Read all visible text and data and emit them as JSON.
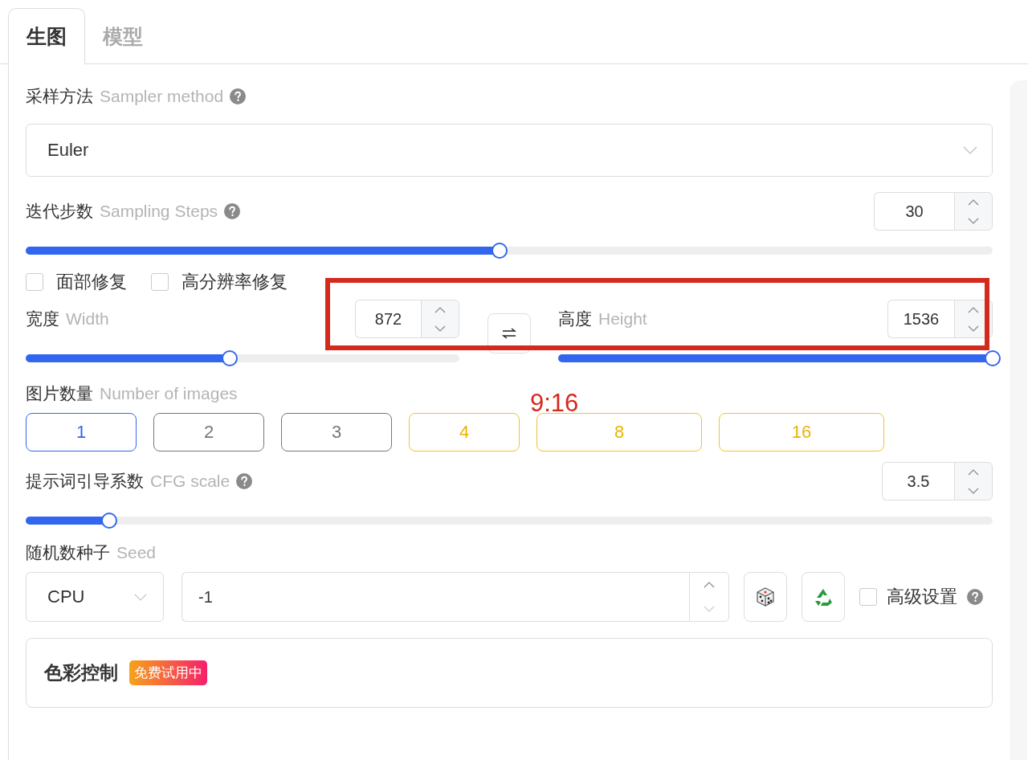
{
  "tabs": [
    {
      "label": "生图",
      "selected": true
    },
    {
      "label": "模型",
      "selected": false
    }
  ],
  "sampler": {
    "label": "采样方法",
    "hint": "Sampler method",
    "help": true,
    "value": "Euler"
  },
  "steps": {
    "label": "迭代步数",
    "hint": "Sampling Steps",
    "help": true,
    "value": "30",
    "level": 0.49
  },
  "options": [
    {
      "label": "面部修复",
      "checked": false
    },
    {
      "label": "高分辨率修复",
      "checked": false
    }
  ],
  "width": {
    "label": "宽度",
    "hint": "Width",
    "value": "872",
    "level": 0.47
  },
  "height": {
    "label": "高度",
    "hint": "Height",
    "value": "1536",
    "level": 1
  },
  "images": {
    "label": "图片数量",
    "hint": "Number of images",
    "options": [
      {
        "label": "1",
        "selected": true,
        "kind": "standard"
      },
      {
        "label": "2",
        "selected": false,
        "kind": "standard"
      },
      {
        "label": "3",
        "selected": false,
        "kind": "standard"
      },
      {
        "label": "4",
        "selected": false,
        "kind": "premium"
      },
      {
        "label": "8",
        "selected": false,
        "kind": "premium"
      },
      {
        "label": "16",
        "selected": false,
        "kind": "premium"
      }
    ]
  },
  "cfg": {
    "label": "提示词引导系数",
    "hint": "CFG scale",
    "help": true,
    "value": "3.5",
    "level": 0.086
  },
  "seed": {
    "label": "随机数种子",
    "hint": "Seed",
    "device": "CPU",
    "value": "-1"
  },
  "advanced": {
    "label": "高级设置",
    "checked": false,
    "help": true
  },
  "color_control": {
    "title": "色彩控制",
    "badge": "免费试用中"
  },
  "annotation": {
    "text": "9:16"
  }
}
